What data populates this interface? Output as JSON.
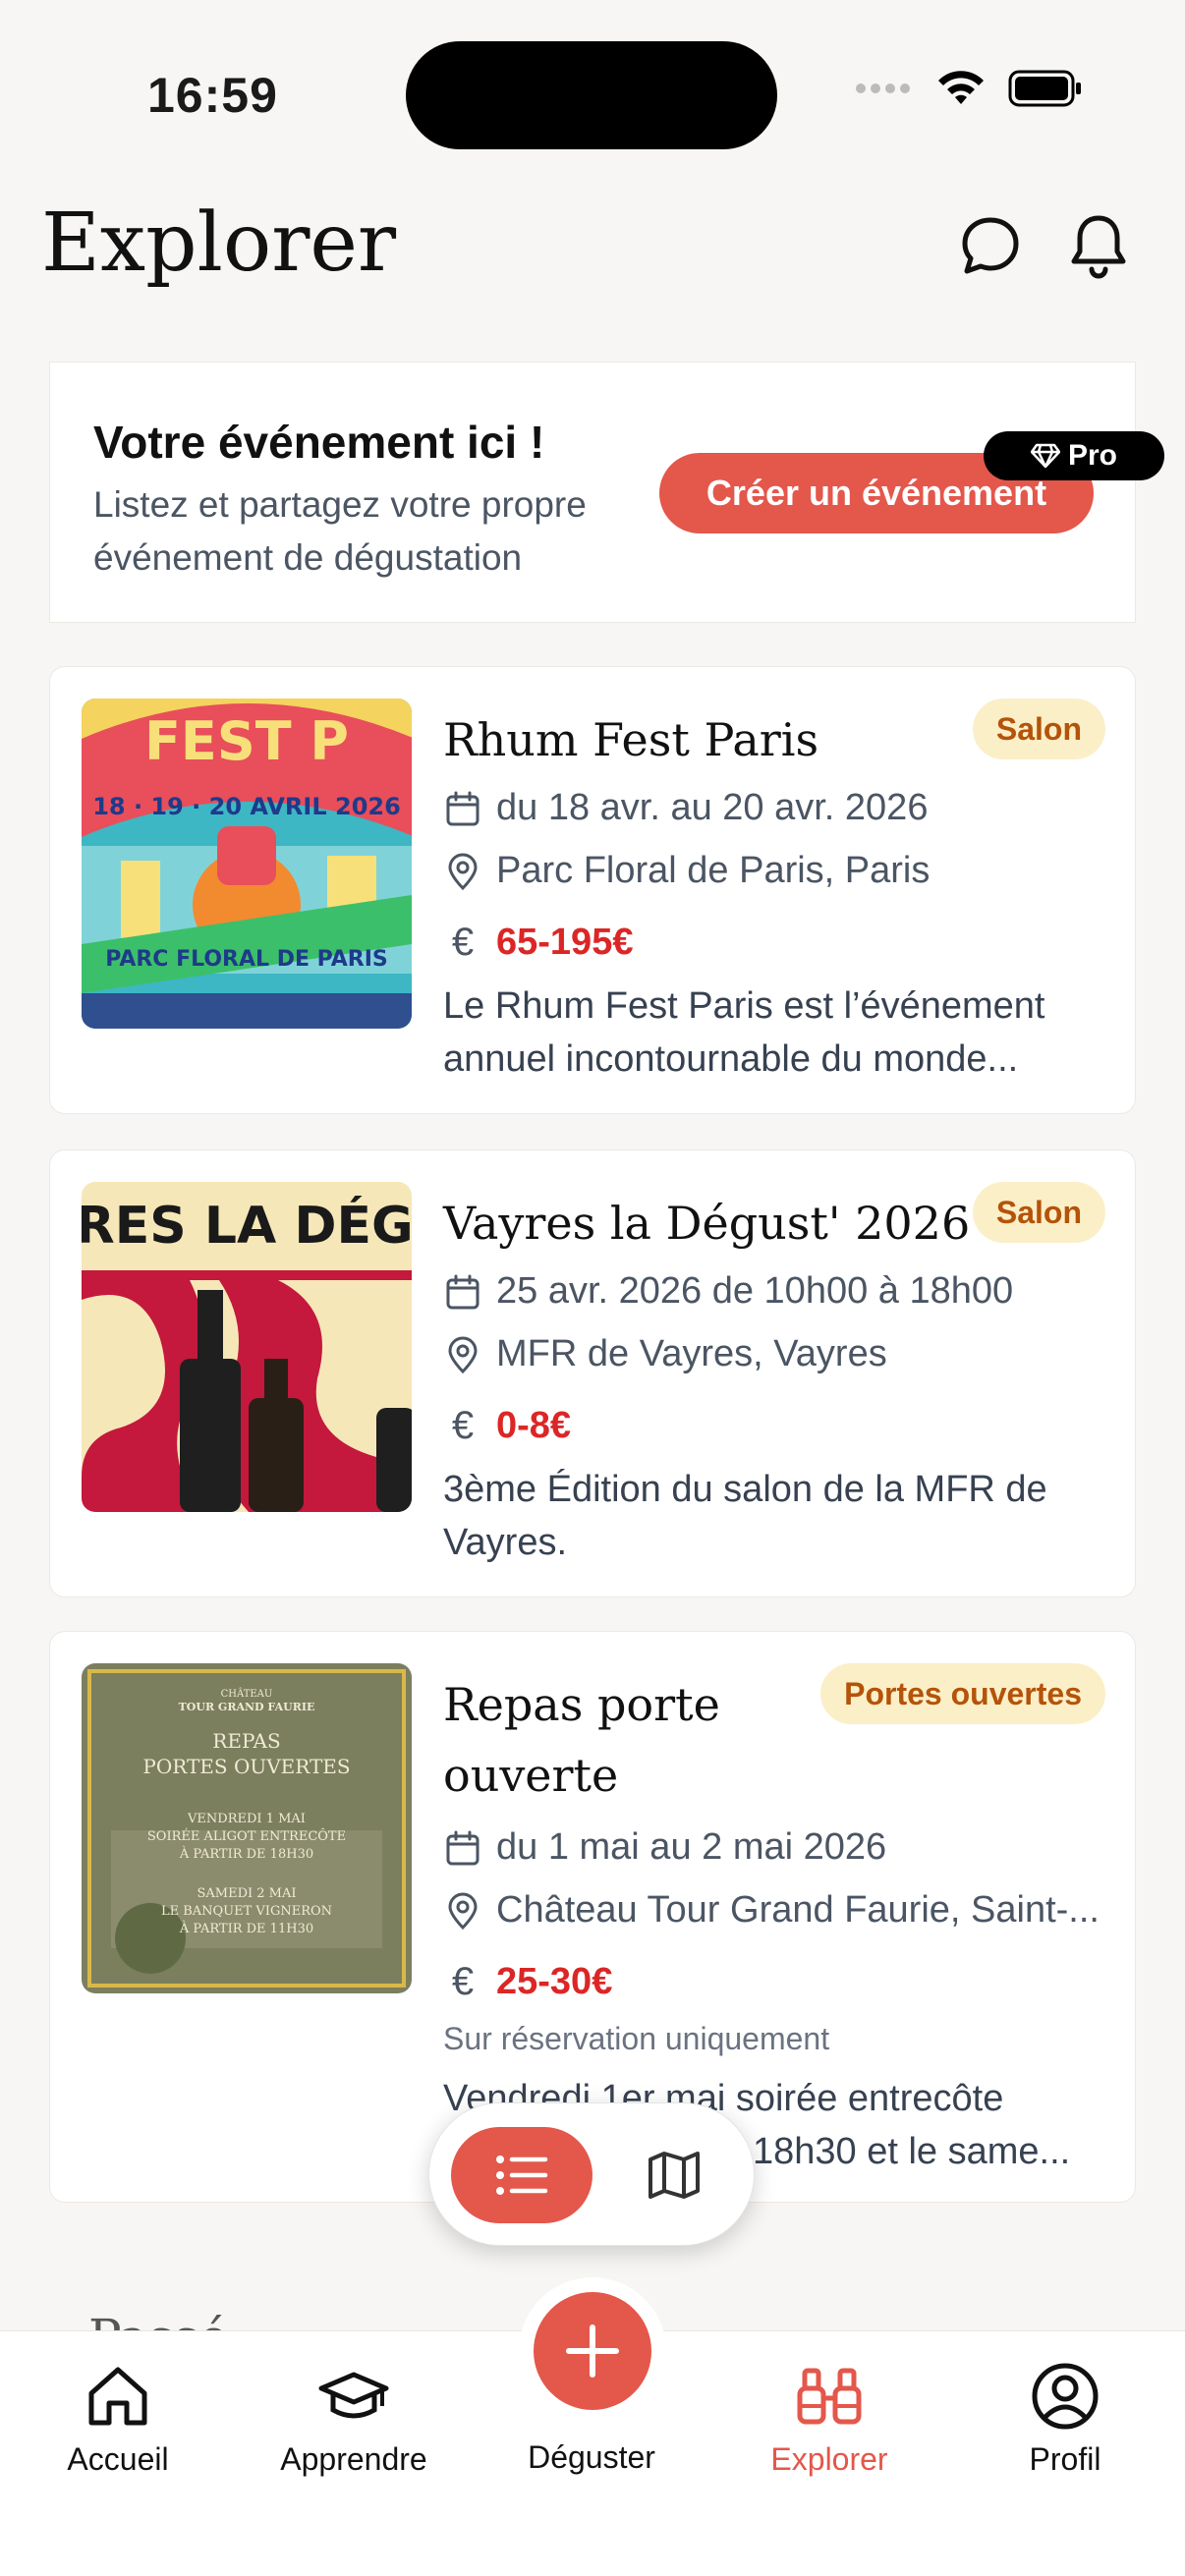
{
  "status_bar": {
    "time": "16:59"
  },
  "header": {
    "title": "Explorer",
    "chat_icon": "chat-bubble-icon",
    "bell_icon": "bell-icon"
  },
  "promo": {
    "title": "Votre événement ici !",
    "description": "Listez et partagez votre propre événement de dégustation",
    "button_label": "Créer un événement",
    "badge_label": "Pro"
  },
  "events": [
    {
      "title": "Rhum Fest Paris",
      "tag": "Salon",
      "date": "du 18 avr. au 20 avr. 2026",
      "location": "Parc Floral de Paris, Paris",
      "price": "65-195€",
      "description": "Le Rhum Fest Paris est l’événement annuel incontournable du monde...",
      "poster_text_top": "FEST P",
      "poster_text_mid": "18 · 19 · 20 AVRIL 2026",
      "poster_text_bottom": "PARC FLORAL DE PARIS"
    },
    {
      "title": "Vayres la Dégust' 2026",
      "tag": "Salon",
      "date": "25 avr. 2026 de 10h00 à 18h00",
      "location": "MFR de Vayres, Vayres",
      "price": "0-8€",
      "description": "3ème Édition du salon de la MFR de Vayres.",
      "poster_text_top": "YRES LA DÉGU"
    },
    {
      "title": "Repas porte ouverte",
      "tag": "Portes ouvertes",
      "date": "du 1 mai au 2 mai 2026",
      "location": "Château Tour Grand Faurie, Saint-...",
      "price": "25-30€",
      "note": "Sur réservation uniquement",
      "description_line1": "Vendredi 1er mai soirée entrecôte",
      "description_line2": "18h30 et le same...",
      "poster_text_1": "CHÂTEAU",
      "poster_text_2": "TOUR GRAND FAURIE",
      "poster_text_3": "REPAS",
      "poster_text_4": "PORTES OUVERTES",
      "poster_text_5": "VENDREDI 1 MAI",
      "poster_text_6": "SOIRÉE ALIGOT ENTRECÔTE",
      "poster_text_7": "À PARTIR DE 18H30",
      "poster_text_8": "SAMEDI 2 MAI",
      "poster_text_9": "LE BANQUET VIGNERON",
      "poster_text_10": "À PARTIR DE 11H30"
    }
  ],
  "partial_heading": "Passé",
  "view_toggle": {
    "list_icon": "list-icon",
    "map_icon": "map-icon",
    "active": "list"
  },
  "tabbar": [
    {
      "label": "Accueil",
      "icon": "home-icon"
    },
    {
      "label": "Apprendre",
      "icon": "graduation-cap-icon"
    },
    {
      "label": "Déguster",
      "icon": "plus-icon"
    },
    {
      "label": "Explorer",
      "icon": "binoculars-icon",
      "active": true
    },
    {
      "label": "Profil",
      "icon": "user-circle-icon"
    }
  ],
  "colors": {
    "accent": "#e4574b",
    "price": "#dc2626",
    "tag_bg": "#fbefc8",
    "tag_text": "#b45309",
    "background": "#f7f6f4"
  }
}
